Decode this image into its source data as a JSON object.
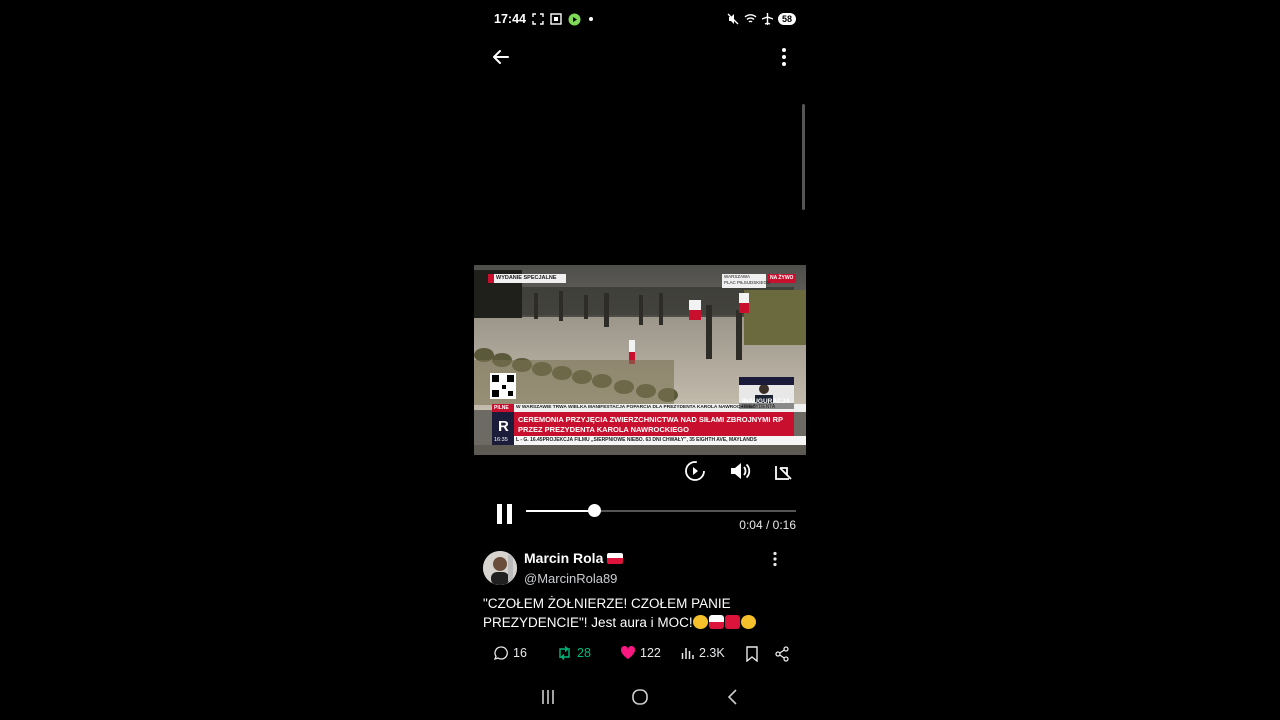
{
  "status_bar": {
    "time": "17:44",
    "battery": "58"
  },
  "video": {
    "overlay": {
      "program_tag": "WYDANIE SPECJALNE",
      "location_line1": "WARSZAWA",
      "location_line2": "PLAC PIŁSUDSKIEGO",
      "live_tag": "NA ŻYWO",
      "breaking_label": "PILNE",
      "ticker_top": "W WARSZAWIE TRWA WIELKA MANIFESTACJA POPARCIA DLA PREZYDENTA KAROLA NAWROCKIEGO",
      "headline_line1": "CEREMONIA PRZYJĘCIA ZWIERZCHNICTWA NAD SIŁAMI ZBROJNYMI RP",
      "headline_line2": "PRZEZ PREZYDENTA KAROLA NAWROCKIEGO",
      "ticker_bottom": "L - G. 16.45PROJEKCJA FILMU „SIERPNIOWE NIEBO. 63 DNI CHWAŁY\", 35 EIGHTH AVE, MAYLANDS",
      "channel_time": "16:35",
      "corner_label1": "INAUGURACJA",
      "corner_label2": "PREZYDENTA"
    },
    "player": {
      "current": "0:04",
      "total": "0:16",
      "time_display": "0:04 / 0:16",
      "progress_fraction": 0.25
    }
  },
  "post": {
    "author_name": "Marcin Rola",
    "author_handle": "@MarcinRola89",
    "text_line1": "\"CZOŁEM ŻOŁNIERZE! CZOŁEM PANIE",
    "text_line2": "PREZYDENCIE\"! Jest aura i MOC!",
    "counts": {
      "replies": "16",
      "reposts": "28",
      "likes": "122",
      "views": "2.3K"
    }
  },
  "colors": {
    "background": "#000000",
    "repost_green": "#00ba7c",
    "like_pink": "#f91880",
    "news_red": "#c8102e",
    "text": "#e7e9ea"
  },
  "icons": [
    "back-arrow-icon",
    "more-vertical-icon",
    "replay-icon",
    "volume-icon",
    "exit-fullscreen-icon",
    "pause-icon",
    "reply-icon",
    "repost-icon",
    "heart-icon",
    "views-icon",
    "bookmark-icon",
    "share-icon",
    "recents-icon",
    "home-icon",
    "nav-back-icon"
  ]
}
